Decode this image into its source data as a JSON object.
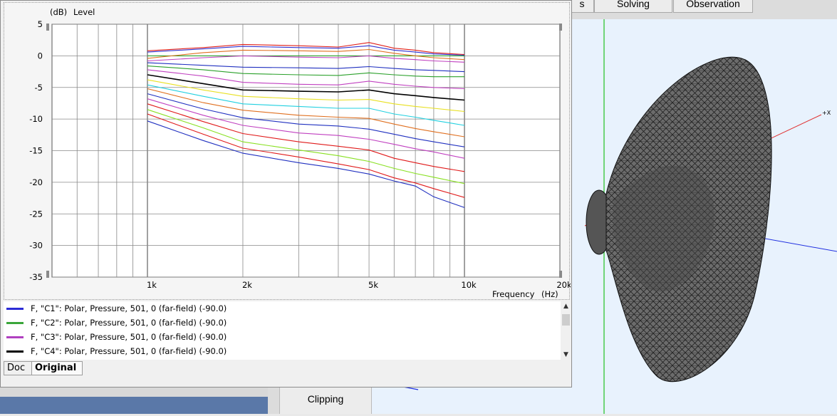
{
  "background_app": {
    "tabs": [
      {
        "label": "s"
      },
      {
        "label": "Solving"
      },
      {
        "label": "Observation"
      }
    ],
    "clipping_button": "Clipping",
    "axis_label": "+X"
  },
  "legend": {
    "items": [
      {
        "text": "F, \"C1\": Polar, Pressure, 501, 0 (far-field) (-90.0)",
        "color": "#2b2bd6"
      },
      {
        "text": "F, \"C2\": Polar, Pressure, 501, 0 (far-field) (-90.0)",
        "color": "#3aa63a"
      },
      {
        "text": "F, \"C3\": Polar, Pressure, 501, 0 (far-field) (-90.0)",
        "color": "#b040c0"
      },
      {
        "text": "F, \"C4\": Polar, Pressure, 501, 0 (far-field) (-90.0)",
        "color": "#000000"
      }
    ]
  },
  "bottom_tabs": [
    {
      "label": "Doc"
    },
    {
      "label": "Original"
    }
  ],
  "chart_data": {
    "type": "line",
    "ylabel_unit": "(dB)",
    "ylabel": "Level",
    "xlabel": "Frequency",
    "xlabel_unit": "(Hz)",
    "x_scale": "log",
    "xlim": [
      500,
      20000
    ],
    "ylim": [
      -35,
      5
    ],
    "x_ticks": [
      {
        "v": 1000,
        "label": "1k"
      },
      {
        "v": 2000,
        "label": "2k"
      },
      {
        "v": 5000,
        "label": "5k"
      },
      {
        "v": 10000,
        "label": "10k"
      },
      {
        "v": 20000,
        "label": "20k"
      }
    ],
    "y_ticks": [
      5,
      0,
      -5,
      -10,
      -15,
      -20,
      -25,
      -30,
      -35
    ],
    "grid": true,
    "x": [
      1000,
      1500,
      2000,
      3000,
      4000,
      5000,
      6000,
      7000,
      8000,
      10000
    ],
    "series": [
      {
        "color": "#e0201a",
        "values": [
          0.8,
          1.3,
          1.8,
          1.6,
          1.4,
          2.1,
          1.2,
          0.9,
          0.5,
          0.2
        ]
      },
      {
        "color": "#3030d0",
        "values": [
          0.6,
          1.1,
          1.5,
          1.3,
          1.2,
          1.6,
          0.9,
          0.6,
          0.3,
          0.1
        ]
      },
      {
        "color": "#2aa02a",
        "values": [
          0.0,
          0.0,
          0.0,
          0.0,
          0.0,
          0.0,
          0.0,
          0.0,
          0.0,
          0.0
        ]
      },
      {
        "color": "#e07020",
        "values": [
          -0.4,
          0.5,
          0.9,
          0.8,
          0.7,
          1.0,
          0.4,
          0.0,
          -0.3,
          -0.6
        ]
      },
      {
        "color": "#c040c0",
        "values": [
          -0.8,
          -0.3,
          0.0,
          -0.2,
          -0.3,
          0.0,
          -0.4,
          -0.6,
          -0.8,
          -1.0
        ]
      },
      {
        "color": "#2030c0",
        "values": [
          -1.1,
          -1.5,
          -1.8,
          -1.9,
          -2.0,
          -1.7,
          -2.0,
          -2.2,
          -2.3,
          -2.5
        ]
      },
      {
        "color": "#2aa02a",
        "values": [
          -1.6,
          -2.2,
          -2.8,
          -3.0,
          -3.1,
          -2.7,
          -3.0,
          -3.2,
          -3.3,
          -3.3
        ]
      },
      {
        "color": "#c040c0",
        "values": [
          -2.2,
          -3.2,
          -4.2,
          -4.5,
          -4.6,
          -4.0,
          -4.5,
          -4.8,
          -5.0,
          -5.2
        ]
      },
      {
        "color": "#000000",
        "values": [
          -3.0,
          -4.4,
          -5.4,
          -5.6,
          -5.7,
          -5.4,
          -6.0,
          -6.3,
          -6.6,
          -7.0
        ]
      },
      {
        "color": "#e8e020",
        "values": [
          -3.8,
          -5.4,
          -6.4,
          -6.8,
          -7.0,
          -6.9,
          -7.6,
          -8.0,
          -8.3,
          -8.8
        ]
      },
      {
        "color": "#20d0e0",
        "values": [
          -4.6,
          -6.4,
          -7.6,
          -8.0,
          -8.3,
          -8.3,
          -9.2,
          -9.7,
          -10.2,
          -11.0
        ]
      },
      {
        "color": "#e07020",
        "values": [
          -5.2,
          -7.4,
          -8.6,
          -9.4,
          -9.7,
          -9.9,
          -10.8,
          -11.5,
          -12.0,
          -12.8
        ]
      },
      {
        "color": "#2030c0",
        "values": [
          -6.0,
          -8.4,
          -9.8,
          -10.8,
          -11.1,
          -11.6,
          -12.4,
          -13.1,
          -13.6,
          -14.4
        ]
      },
      {
        "color": "#c040c0",
        "values": [
          -6.8,
          -9.4,
          -11.0,
          -12.2,
          -12.6,
          -13.2,
          -14.0,
          -14.7,
          -15.2,
          -16.2
        ]
      },
      {
        "color": "#e01a1a",
        "values": [
          -7.6,
          -10.4,
          -12.3,
          -13.6,
          -14.3,
          -14.9,
          -16.2,
          -16.9,
          -17.5,
          -18.3
        ]
      },
      {
        "color": "#88e020",
        "values": [
          -8.5,
          -11.4,
          -13.6,
          -14.9,
          -15.8,
          -16.7,
          -17.8,
          -18.6,
          -19.2,
          -20.2
        ]
      },
      {
        "color": "#e01a1a",
        "values": [
          -9.2,
          -12.4,
          -14.6,
          -16.0,
          -17.1,
          -18.0,
          -19.3,
          -20.1,
          -21.0,
          -22.4
        ]
      },
      {
        "color": "#2030c0",
        "values": [
          -10.3,
          -13.4,
          -15.4,
          -16.9,
          -17.8,
          -18.7,
          -19.8,
          -20.6,
          -22.3,
          -24.0
        ]
      }
    ]
  }
}
